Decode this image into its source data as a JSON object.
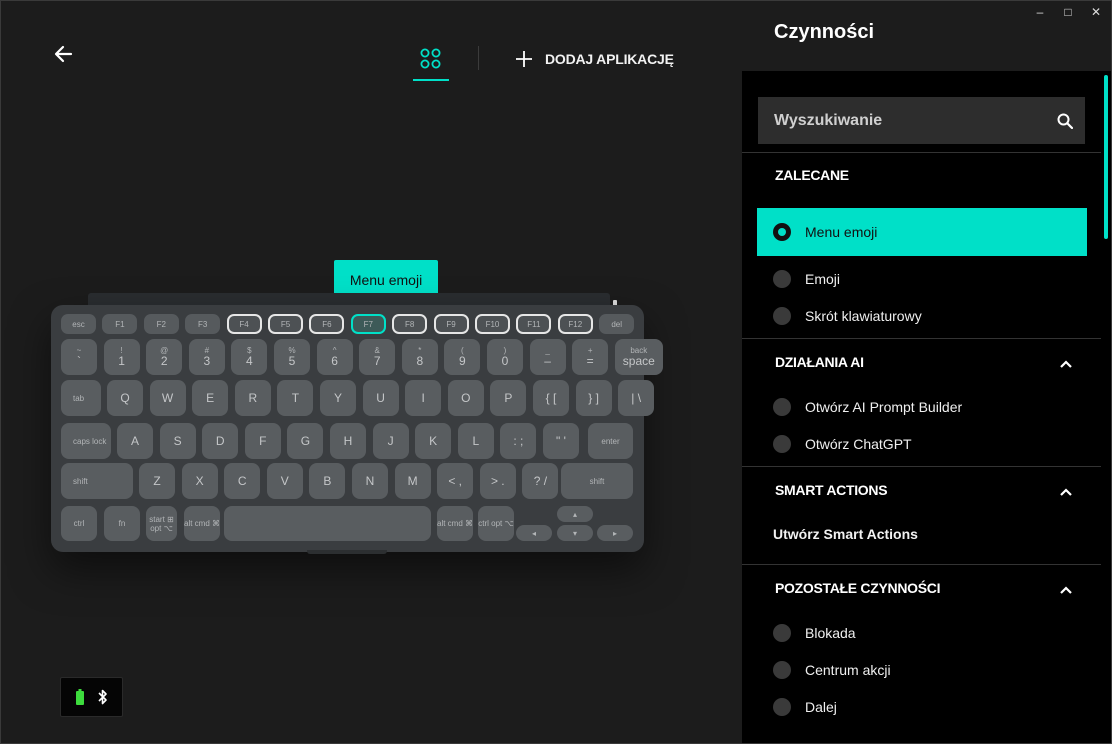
{
  "header": {
    "add_app_label": "DODAJ APLIKACJĘ"
  },
  "window_controls": {
    "minimize": "–",
    "maximize": "□",
    "close": "✕"
  },
  "tooltip": {
    "label": "Menu emoji"
  },
  "keyboard": {
    "fn_row": [
      {
        "label": "esc",
        "state": "normal"
      },
      {
        "label": "F1",
        "state": "normal"
      },
      {
        "label": "F2",
        "state": "normal"
      },
      {
        "label": "F3",
        "state": "normal"
      },
      {
        "label": "F4",
        "state": "highlighted"
      },
      {
        "label": "F5",
        "state": "highlighted"
      },
      {
        "label": "F6",
        "state": "highlighted"
      },
      {
        "label": "F7",
        "state": "selected"
      },
      {
        "label": "F8",
        "state": "highlighted"
      },
      {
        "label": "F9",
        "state": "highlighted"
      },
      {
        "label": "F10",
        "state": "highlighted"
      },
      {
        "label": "F11",
        "state": "highlighted"
      },
      {
        "label": "F12",
        "state": "highlighted"
      },
      {
        "label": "del",
        "state": "normal"
      }
    ],
    "number_row": [
      {
        "top": "~",
        "bottom": "`"
      },
      {
        "top": "!",
        "bottom": "1"
      },
      {
        "top": "@",
        "bottom": "2"
      },
      {
        "top": "#",
        "bottom": "3"
      },
      {
        "top": "$",
        "bottom": "4"
      },
      {
        "top": "%",
        "bottom": "5"
      },
      {
        "top": "^",
        "bottom": "6"
      },
      {
        "top": "&",
        "bottom": "7"
      },
      {
        "top": "*",
        "bottom": "8"
      },
      {
        "top": "(",
        "bottom": "9"
      },
      {
        "top": ")",
        "bottom": "0"
      },
      {
        "top": "_",
        "bottom": "–"
      },
      {
        "top": "+",
        "bottom": "="
      },
      {
        "top": "back",
        "bottom": "space"
      }
    ],
    "qwerty_row": [
      "tab",
      "Q",
      "W",
      "E",
      "R",
      "T",
      "Y",
      "U",
      "I",
      "O",
      "P",
      "{ [",
      "} ]",
      "| \\"
    ],
    "home_row": [
      "caps lock",
      "A",
      "S",
      "D",
      "F",
      "G",
      "H",
      "J",
      "K",
      "L",
      ": ;",
      "\" '",
      "enter"
    ],
    "shift_row": [
      "shift",
      "Z",
      "X",
      "C",
      "V",
      "B",
      "N",
      "M",
      "< ,",
      "> .",
      "? /",
      "shift"
    ],
    "bottom_row": [
      "ctrl",
      "fn",
      "start ⊞ opt ⌥",
      "alt cmd ⌘",
      "",
      "alt cmd ⌘",
      "ctrl opt ⌥",
      "◂",
      "▴ ▾",
      "▸"
    ]
  },
  "panel": {
    "title": "Czynności",
    "search_placeholder": "Wyszukiwanie",
    "sections": {
      "recommended": {
        "title": "ZALECANE",
        "options": [
          "Menu emoji",
          "Emoji",
          "Skrót klawiaturowy"
        ],
        "selected": "Menu emoji"
      },
      "ai": {
        "title": "DZIAŁANIA AI",
        "options": [
          "Otwórz AI Prompt Builder",
          "Otwórz ChatGPT"
        ]
      },
      "smart": {
        "title": "SMART ACTIONS",
        "link": "Utwórz Smart Actions"
      },
      "other": {
        "title": "POZOSTAŁE CZYNNOŚCI",
        "options": [
          "Blokada",
          "Centrum akcji",
          "Dalej"
        ]
      }
    }
  },
  "colors": {
    "accent": "#00e0c8",
    "panel_bg": "#000000",
    "main_bg": "#1c1c1c",
    "key": "#595d60",
    "keyboard_body": "#3a3d40"
  }
}
